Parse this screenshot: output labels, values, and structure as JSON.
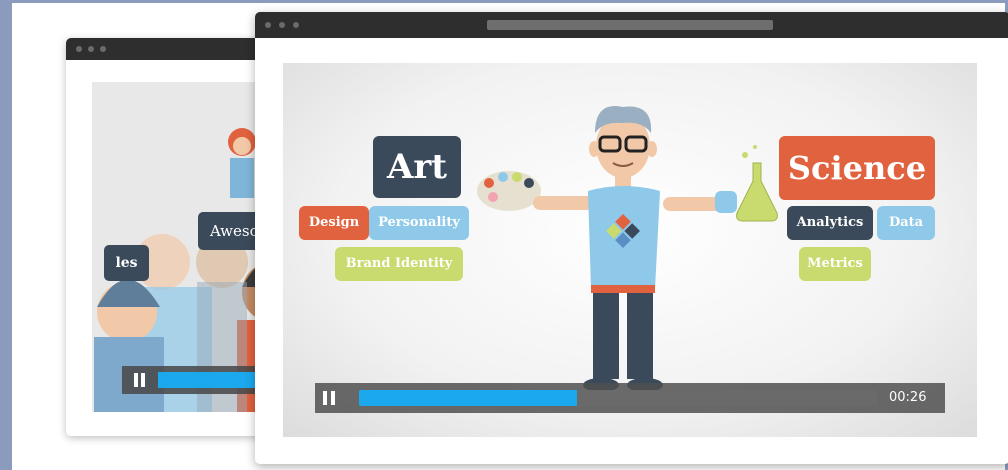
{
  "back_window": {
    "bubble_awesome": "Awesome",
    "bubble_les": "les",
    "progress_fraction": 1.0
  },
  "front_window": {
    "art_label": "Art",
    "science_label": "Science",
    "art_tags": [
      "Design",
      "Personality",
      "Brand Identity"
    ],
    "science_tags": [
      "Analytics",
      "Data",
      "Metrics"
    ],
    "player": {
      "time": "00:26",
      "progress_fraction": 0.42
    }
  },
  "colors": {
    "dark_slate": "#3b4a5a",
    "orange": "#e1623e",
    "light_blue": "#8ec9ea",
    "lime": "#c9da6e",
    "progress_blue": "#1ba8ec"
  },
  "icons": {
    "pause": "pause-icon"
  }
}
